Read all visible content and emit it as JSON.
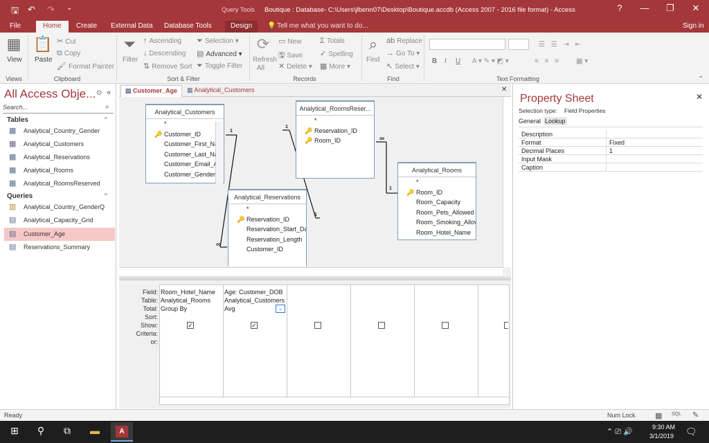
{
  "window": {
    "context_tab": "Query Tools",
    "title": "Boutique : Database- C:\\Users\\jlbenn07\\Desktop\\Boutique.accdb (Access 2007 - 2016 file format) - Access",
    "help": "?",
    "minimize": "—",
    "restore": "❐",
    "close": "✕"
  },
  "qat": {
    "save": "🖫",
    "undo": "↶",
    "redo": "↷",
    "customize": "⌄"
  },
  "ribbon_tabs": [
    "File",
    "Home",
    "Create",
    "External Data",
    "Database Tools",
    "Design"
  ],
  "active_tab": "Home",
  "tell_me": "Tell me what you want to do...",
  "sign_in": "Sign in",
  "ribbon": {
    "views": {
      "view": "View",
      "label": "Views"
    },
    "clipboard": {
      "paste": "Paste",
      "cut": "Cut",
      "copy": "Copy",
      "format_painter": "Format Painter",
      "label": "Clipboard"
    },
    "sort_filter": {
      "filter": "Filter",
      "ascending": "Ascending",
      "descending": "Descending",
      "remove_sort": "Remove Sort",
      "selection": "Selection",
      "advanced": "Advanced",
      "toggle_filter": "Toggle Filter",
      "label": "Sort & Filter"
    },
    "records": {
      "refresh": "Refresh",
      "refresh_sub": "All",
      "new": "New",
      "save": "Save",
      "delete": "Delete",
      "totals": "Totals",
      "spelling": "Spelling",
      "more": "More",
      "label": "Records"
    },
    "find": {
      "find": "Find",
      "replace": "Replace",
      "goto": "Go To",
      "select": "Select",
      "label": "Find"
    },
    "text_formatting": {
      "label": "Text Formatting",
      "bold": "B",
      "italic": "I",
      "underline": "U"
    }
  },
  "nav": {
    "title": "All Access Obje...",
    "search_placeholder": "Search...",
    "tables_header": "Tables",
    "tables": [
      "Analytical_Country_Gender",
      "Analytical_Customers",
      "Analytical_Reservations",
      "Analytical_Rooms",
      "Analytical_RoomsReserved"
    ],
    "queries_header": "Queries",
    "queries": [
      "Analytical_Country_GenderQ",
      "Analytical_Capacity_Grid",
      "Customer_Age",
      "Reservations_Summary"
    ],
    "selected_query": "Customer_Age"
  },
  "doc_tabs": [
    "Customer_Age",
    "Analytical_Customers"
  ],
  "doc_close": "✕",
  "tables": {
    "customers": {
      "title": "Analytical_Customers",
      "fields": [
        "*",
        "Customer_ID",
        "Customer_First_Na",
        "Customer_Last_Na",
        "Customer_Email_A",
        "Customer_Gender"
      ]
    },
    "roomsreserved": {
      "title": "Analytical_RoomsReser...",
      "fields": [
        "*",
        "Reservation_ID",
        "Room_ID"
      ]
    },
    "rooms": {
      "title": "Analytical_Rooms",
      "fields": [
        "*",
        "Room_ID",
        "Room_Capacity",
        "Room_Pets_Allowed",
        "Room_Smoking_Allov",
        "Room_Hotel_Name"
      ]
    },
    "reservations": {
      "title": "Analytical_Reservations",
      "fields": [
        "*",
        "Reservation_ID",
        "Reservation_Start_Dat",
        "Reservation_Length",
        "Customer_ID"
      ]
    }
  },
  "rel_labels": {
    "one": "1",
    "many": "∞"
  },
  "grid": {
    "row_labels": [
      "Field:",
      "Table:",
      "Total:",
      "Sort:",
      "Show:",
      "Criteria:",
      "or:"
    ],
    "columns": [
      {
        "field": "Room_Hotel_Name",
        "table": "Analytical_Rooms",
        "total": "Group By",
        "show": true
      },
      {
        "field": "Age: Customer_DOB",
        "table": "Analytical_Customers",
        "total": "Avg",
        "show": true
      },
      {
        "field": "",
        "table": "",
        "total": "",
        "show": false
      },
      {
        "field": "",
        "table": "",
        "total": "",
        "show": false
      },
      {
        "field": "",
        "table": "",
        "total": "",
        "show": false
      }
    ]
  },
  "property_sheet": {
    "title": "Property Sheet",
    "selection_type_label": "Selection type:",
    "selection_type": "Field Properties",
    "tabs": [
      "General",
      "Lookup"
    ],
    "rows": [
      {
        "name": "Description",
        "value": ""
      },
      {
        "name": "Format",
        "value": "Fixed"
      },
      {
        "name": "Decimal Places",
        "value": "1"
      },
      {
        "name": "Input Mask",
        "value": ""
      },
      {
        "name": "Caption",
        "value": ""
      }
    ],
    "close": "✕"
  },
  "status": {
    "ready": "Ready",
    "num_lock": "Num Lock",
    "sql": "SQL"
  },
  "taskbar": {
    "time": "9:30 AM",
    "date": "3/1/2019",
    "app_badge": "A"
  }
}
